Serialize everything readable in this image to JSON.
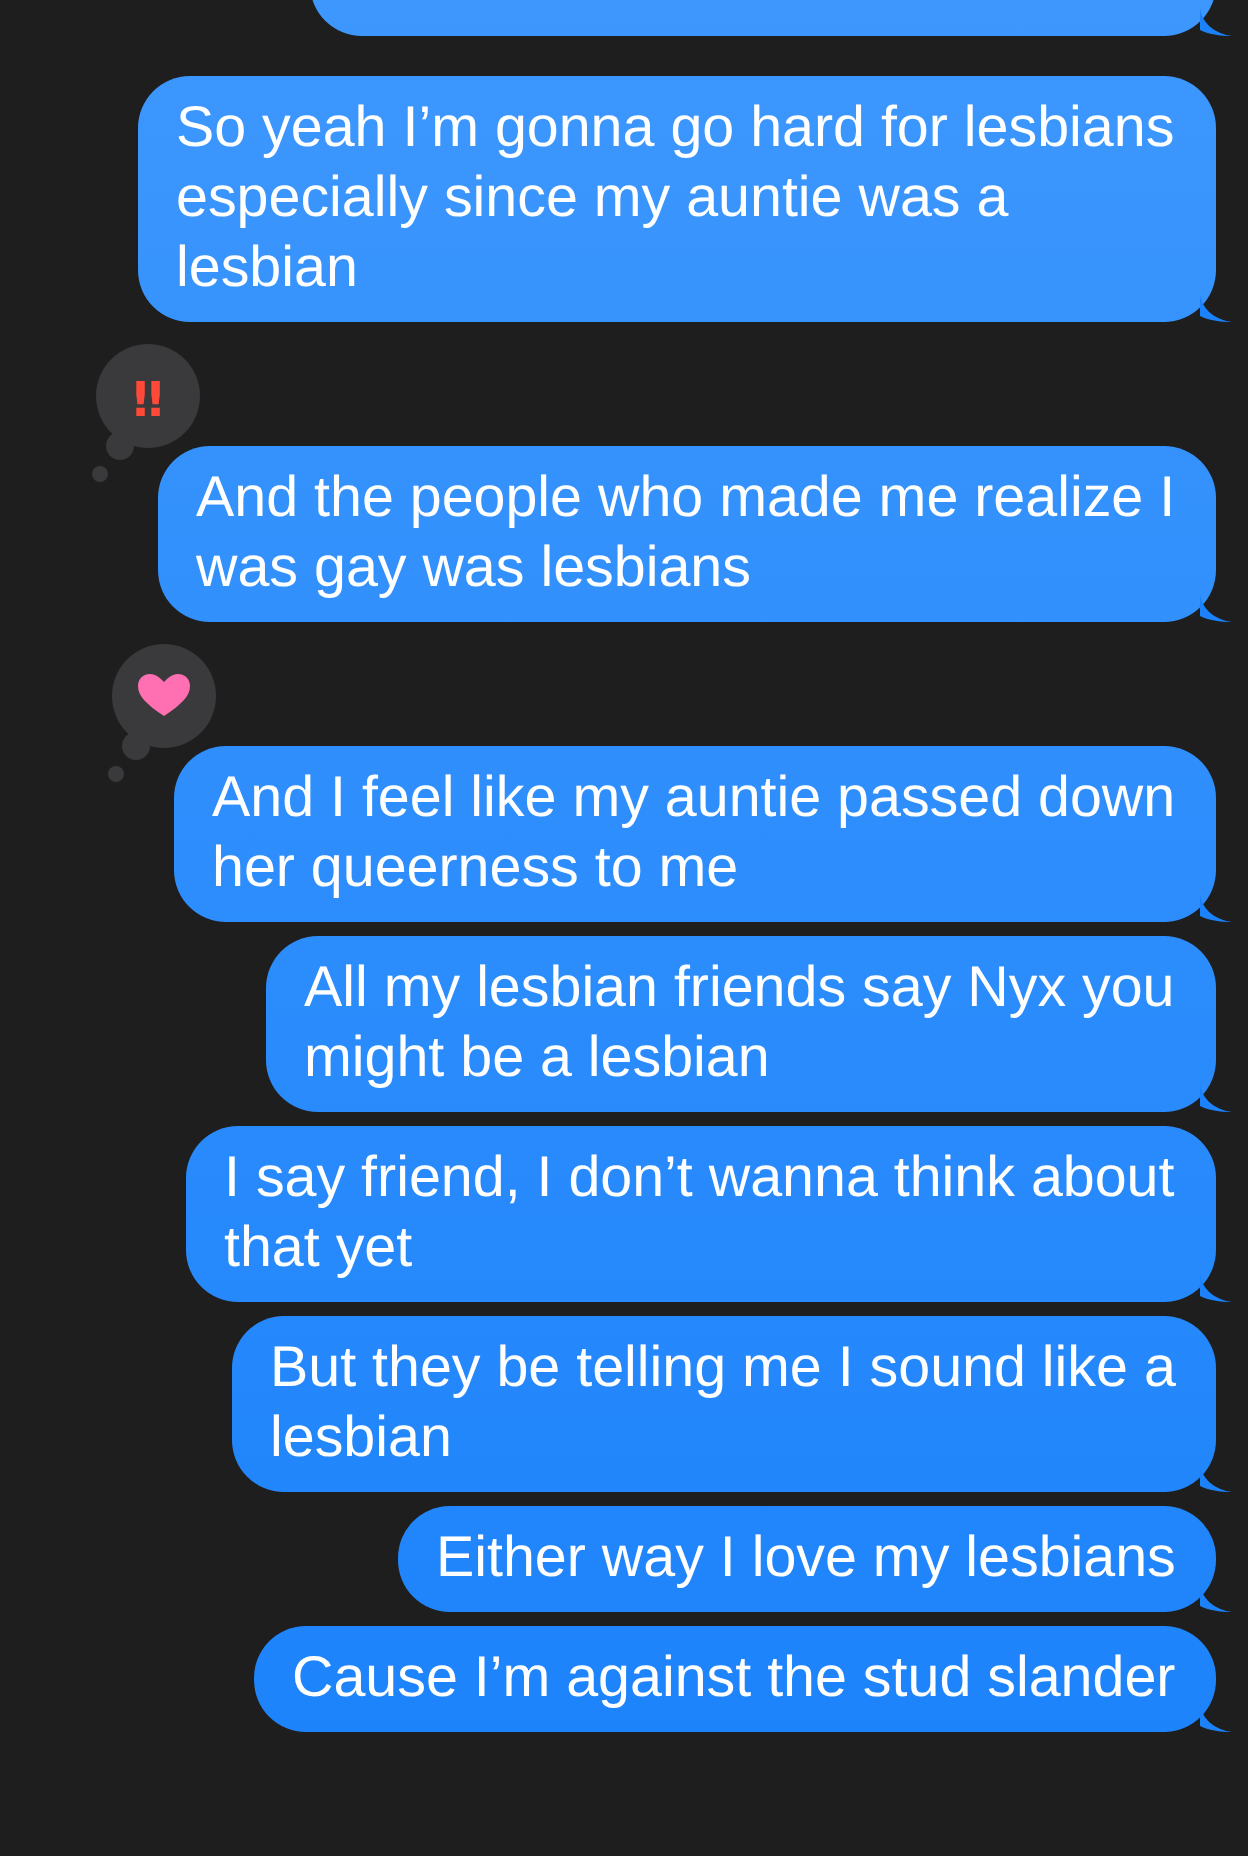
{
  "messages": [
    {
      "cut": true
    },
    {
      "text": "So yeah I’m gonna go hard for lesbians especially since my auntie was a lesbian"
    },
    {
      "text": "And the people who made me realize I was gay was lesbians",
      "reaction": {
        "kind": "emphasis",
        "glyph": "‼"
      }
    },
    {
      "text": "And I feel like my auntie passed down her queerness to me",
      "reaction": {
        "kind": "heart"
      }
    },
    {
      "text": "All my lesbian friends say Nyx you might be a lesbian"
    },
    {
      "text": "I say friend, I don’t wanna think about that yet"
    },
    {
      "text": "But they be telling me I sound like a lesbian"
    },
    {
      "text": "Either way I love my lesbians"
    },
    {
      "text": "Cause I’m against the stud slander"
    }
  ]
}
